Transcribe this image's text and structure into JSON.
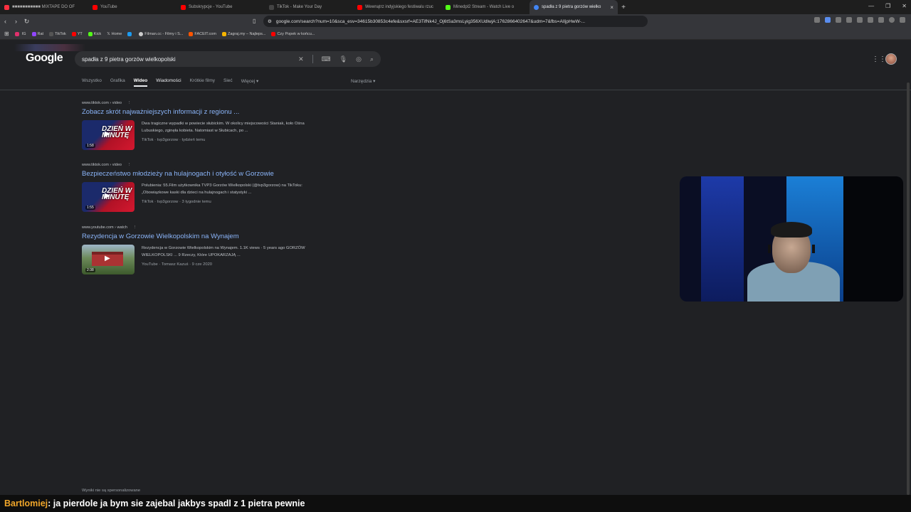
{
  "browser": {
    "tabs": [
      {
        "title": "■■■■■■■■■■■ MIXTAPE DO OF",
        "fav_color": "#ff3040"
      },
      {
        "title": "YouTube",
        "fav_color": "#ff0000"
      },
      {
        "title": "Subskrypcje - YouTube",
        "fav_color": "#ff0000"
      },
      {
        "title": "TikTok - Make Your Day",
        "fav_color": "#222222"
      },
      {
        "title": "Wewnątrz indyjskiego festiwalu rzuc",
        "fav_color": "#ff0000"
      },
      {
        "title": "Minedpl2 Stream - Watch Live o",
        "fav_color": "#53fc18"
      },
      {
        "title": "spadła z 9 pietra gorzów wielko",
        "fav_color": "#4285f4",
        "active": true
      }
    ],
    "url": "google.com/search?num=10&sca_esv=34615b30853c4efe&sxsrf=AE3TifNk4J_Oj6tSa3msLyig356XUdlwjA:1762866402647&udm=7&fbs=AIljpHwW-...",
    "bookmarks": [
      {
        "label": "IG",
        "color": "#e1306c"
      },
      {
        "label": "Rat",
        "color": "#9146ff"
      },
      {
        "label": "TikTok",
        "color": "#222222"
      },
      {
        "label": "YT",
        "color": "#ff0000"
      },
      {
        "label": "Kick",
        "color": "#53fc18"
      },
      {
        "label": "Home",
        "color": "#000000"
      },
      {
        "label": "",
        "color": "#1d9bf0"
      },
      {
        "label": "Filman.cc - Filmy i S...",
        "color": "#cccccc"
      },
      {
        "label": "FACEIT.com",
        "color": "#ff5500"
      },
      {
        "label": "Zagraj.my – Najleps...",
        "color": "#f5b400"
      },
      {
        "label": "Czy Popek w końcu...",
        "color": "#ff0000"
      }
    ]
  },
  "google": {
    "logo": "Google",
    "query": "spadła z 9 pietra gorzów wielkopolski",
    "tabs": [
      {
        "label": "Wszystko"
      },
      {
        "label": "Grafika"
      },
      {
        "label": "Wideo",
        "active": true
      },
      {
        "label": "Wiadomości"
      },
      {
        "label": "Krótkie filmy"
      },
      {
        "label": "Sieć"
      },
      {
        "label": "Więcej ▾"
      }
    ],
    "tools": "Narzędzia ▾",
    "results": [
      {
        "source": "www.tiktok.com › video",
        "title": "Zobacz skrót najważniejszych informacji z regionu ...",
        "snippet": "Dwa tragiczne wypadki w powiecie słubickim. W okolicy miejscowości Staniak, koło Ośna Lubuskiego, zginęła kobieta. Natomiast w Słubicach, po ...",
        "meta": "TikTok · tvp3gorzow · tydzień temu",
        "duration": "1:58",
        "thumb_caption": "DZIEŃ W MINUTĘ"
      },
      {
        "source": "www.tiktok.com › video",
        "title": "Bezpieczeństwo młodzieży na hulajnogach i otyłość w Gorzowie",
        "snippet": "Polubienia: 55.Film użytkownika TVP3 Gorzów Wielkopolski (@tvp3gorzow) na TikToku: „Obowiązkowe kaski dla dzieci na hulajnogach i statystyki ...",
        "meta": "TikTok · tvp3gorzow · 3 tygodnie temu",
        "duration": "1:55",
        "thumb_caption": "DZIEŃ W MINUTĘ"
      },
      {
        "source": "www.youtube.com › watch",
        "title": "Rezydencja w Gorzowie Wielkopolskim na Wynajem",
        "snippet": "Rezydencja w Gorzowie Wielkopolskim na Wynajem. 1.1K views · 5 years ago GORZÓW WIELKOPOLSKI ... 9 Rzeczy, Które UPOKARZAJĄ ...",
        "meta": "YouTube · Tomasz Kazuś · 9 cze 2020",
        "duration": "2:38",
        "thumb_caption": ""
      }
    ],
    "footer": "Wyniki nie są spersonalizowane"
  },
  "chat": {
    "user": "Bartlomiej",
    "message": ": ja pierdole ja bym sie zajebal jakbys spadl z 1 pietra pewnie"
  }
}
